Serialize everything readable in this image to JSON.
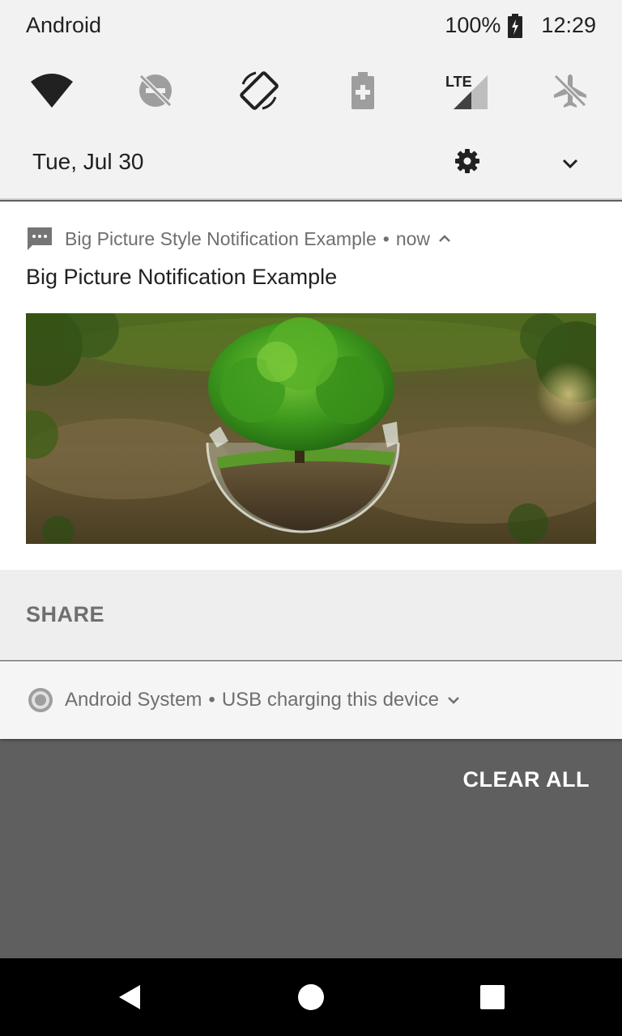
{
  "status_bar": {
    "carrier": "Android",
    "battery": "100%",
    "time": "12:29"
  },
  "quick_settings": {
    "tiles": [
      {
        "icon": "wifi-icon"
      },
      {
        "icon": "do-not-disturb-off-icon"
      },
      {
        "icon": "auto-rotate-icon"
      },
      {
        "icon": "battery-saver-icon"
      },
      {
        "icon": "mobile-data-icon",
        "badge": "LTE"
      },
      {
        "icon": "airplane-mode-icon"
      }
    ],
    "date": "Tue, Jul 30"
  },
  "notification": {
    "app_name": "Big Picture Style Notification Example",
    "separator": "•",
    "when": "now",
    "title": "Big Picture Notification Example",
    "action": "SHARE"
  },
  "system_notification": {
    "app_name": "Android System",
    "separator": "•",
    "text": "USB charging this device"
  },
  "shade": {
    "clear_all": "CLEAR ALL"
  },
  "colors": {
    "shade_background": "#5f5f5f",
    "card_background": "#ffffff",
    "quick_settings_background": "#f2f2f2"
  }
}
